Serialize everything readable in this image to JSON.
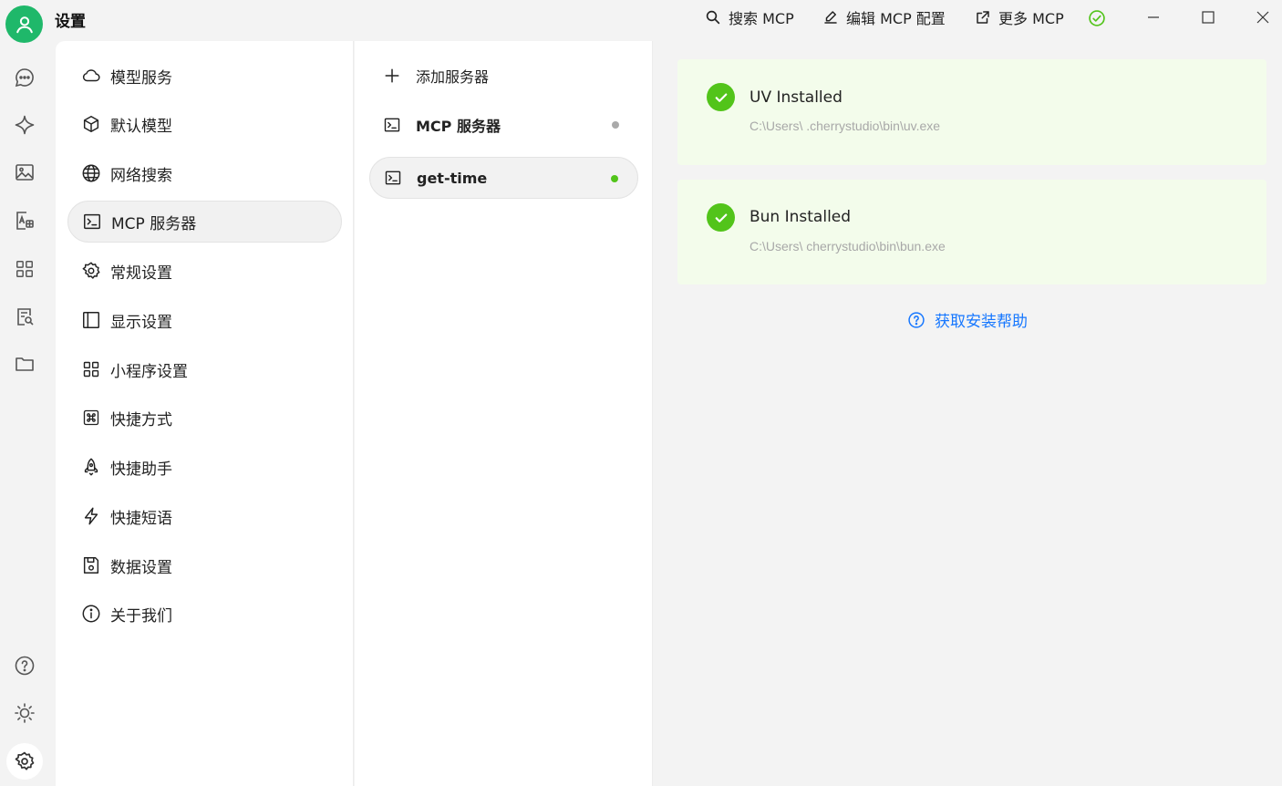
{
  "app": {
    "title": "设置"
  },
  "toolbar": {
    "search_label": "搜索 MCP",
    "edit_label": "编辑 MCP 配置",
    "more_label": "更多 MCP"
  },
  "nav": {
    "items": [
      {
        "label": "模型服务",
        "icon": "cloud-icon"
      },
      {
        "label": "默认模型",
        "icon": "cube-icon"
      },
      {
        "label": "网络搜索",
        "icon": "globe-icon"
      },
      {
        "label": "MCP 服务器",
        "icon": "terminal-icon",
        "active": true
      },
      {
        "label": "常规设置",
        "icon": "gear-icon"
      },
      {
        "label": "显示设置",
        "icon": "layout-icon"
      },
      {
        "label": "小程序设置",
        "icon": "grid-icon"
      },
      {
        "label": "快捷方式",
        "icon": "command-icon"
      },
      {
        "label": "快捷助手",
        "icon": "rocket-icon"
      },
      {
        "label": "快捷短语",
        "icon": "zap-icon"
      },
      {
        "label": "数据设置",
        "icon": "save-icon"
      },
      {
        "label": "关于我们",
        "icon": "info-icon"
      }
    ]
  },
  "mcp": {
    "add_label": "添加服务器",
    "servers": [
      {
        "label": "MCP 服务器",
        "status_color": "#aaaaaa"
      },
      {
        "label": "get-time",
        "status_color": "#52c41a",
        "active": true
      }
    ]
  },
  "content": {
    "uv": {
      "title": "UV Installed",
      "path": "C:\\Users\\      .cherrystudio\\bin\\uv.exe"
    },
    "bun": {
      "title": "Bun Installed",
      "path": "C:\\Users\\          cherrystudio\\bin\\bun.exe"
    },
    "help_label": "获取安装帮助"
  },
  "colors": {
    "accent": "#1fb86a",
    "success": "#52c41a",
    "link": "#1677ff",
    "card_bg": "#f3fceb"
  }
}
